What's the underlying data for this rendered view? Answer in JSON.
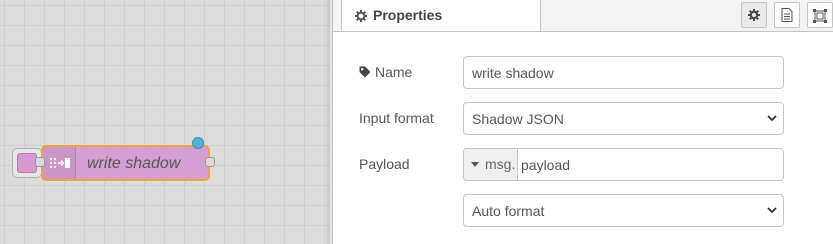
{
  "canvas": {
    "node": {
      "label": "write shadow"
    },
    "colors": {
      "node_fill": "#d59fd4",
      "selected_border": "#f0a53a",
      "status_dot": "#4fb3d9"
    }
  },
  "sidebar": {
    "tab": {
      "label": "Properties",
      "icon": "gear-icon"
    },
    "tools": [
      {
        "name": "settings",
        "icon": "gear-icon"
      },
      {
        "name": "description",
        "icon": "document-icon"
      },
      {
        "name": "appearance",
        "icon": "frame-icon"
      }
    ]
  },
  "form": {
    "name": {
      "label": "Name",
      "value": "write shadow"
    },
    "input_format": {
      "label": "Input format",
      "value": "Shadow JSON"
    },
    "payload": {
      "label": "Payload",
      "type": "msg.",
      "value": "payload"
    },
    "format": {
      "value": "Auto format"
    }
  }
}
